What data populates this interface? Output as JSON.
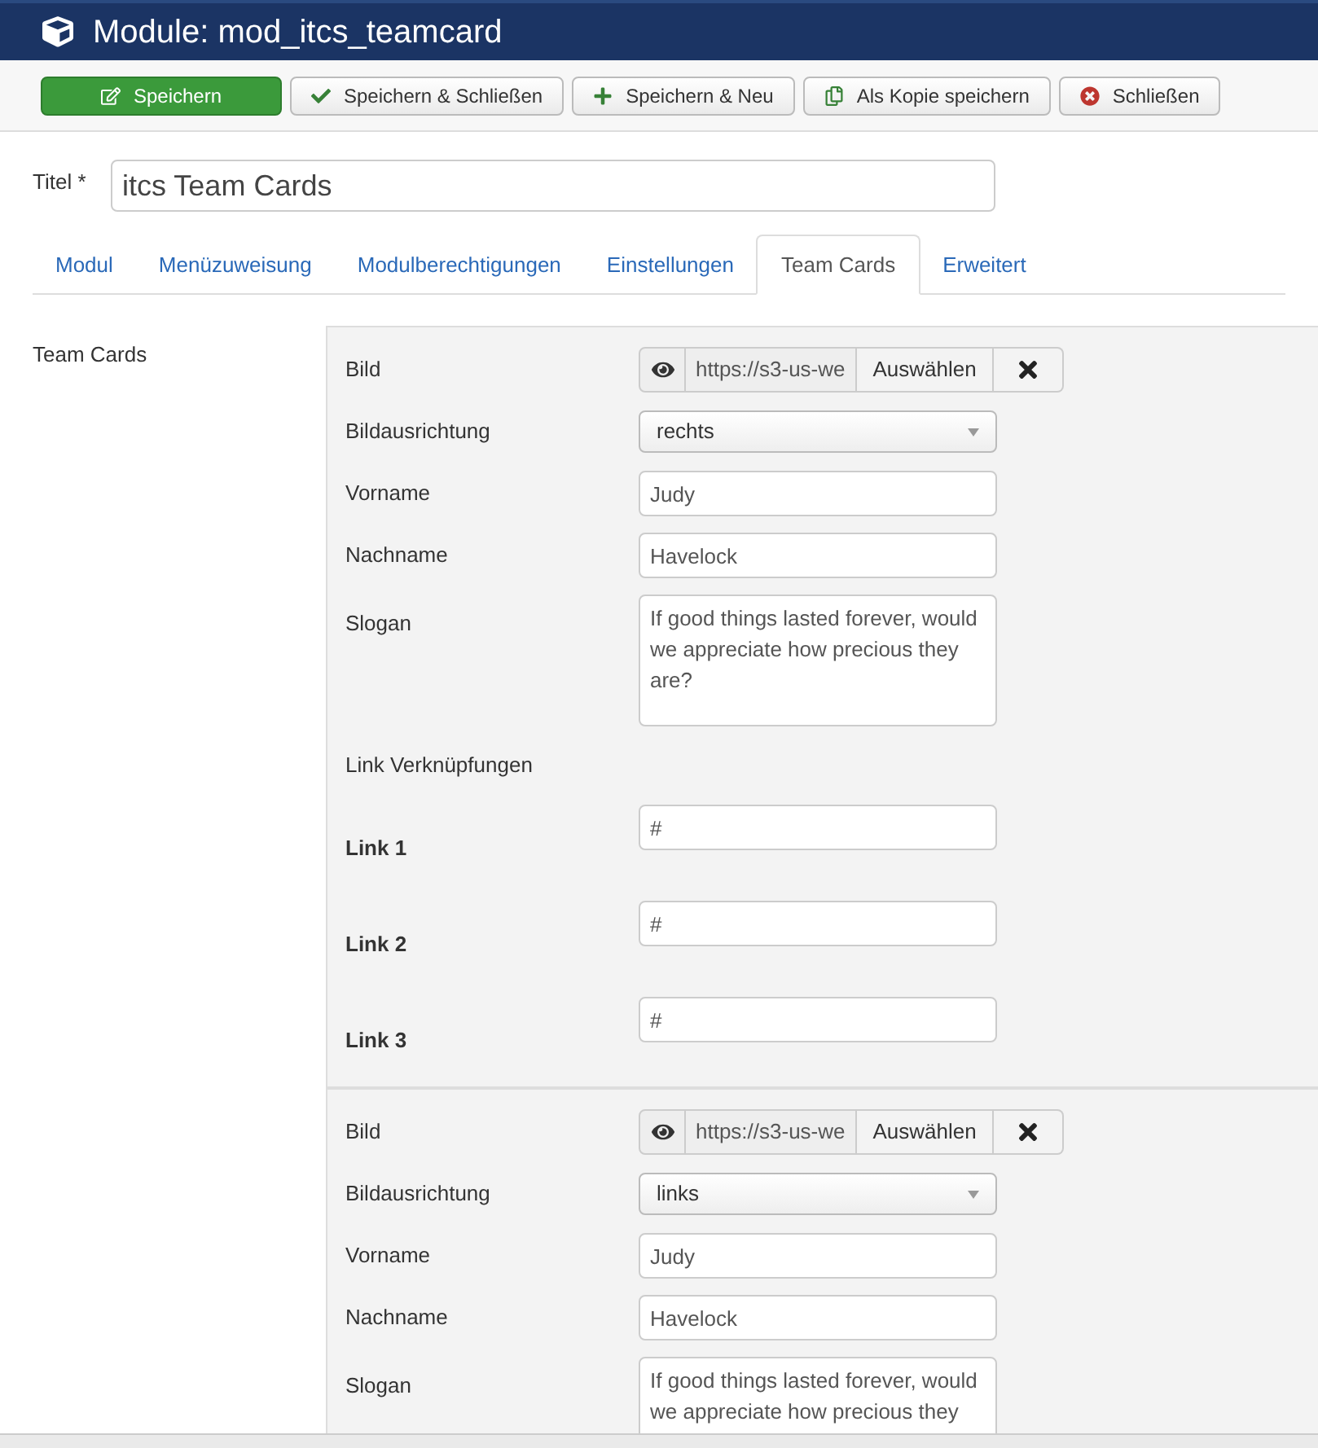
{
  "header": {
    "title": "Module: mod_itcs_teamcard"
  },
  "toolbar": [
    {
      "label": "Speichern",
      "kind": "primary"
    },
    {
      "label": "Speichern & Schließen",
      "kind": "check"
    },
    {
      "label": "Speichern & Neu",
      "kind": "plus"
    },
    {
      "label": "Als Kopie speichern",
      "kind": "copy"
    },
    {
      "label": "Schließen",
      "kind": "close"
    }
  ],
  "title_field": {
    "label": "Titel *",
    "value": "itcs Team Cards"
  },
  "tabs": [
    {
      "label": "Modul",
      "selected": false
    },
    {
      "label": "Menüzuweisung",
      "selected": false
    },
    {
      "label": "Modulberechtigungen",
      "selected": false
    },
    {
      "label": "Einstellungen",
      "selected": false
    },
    {
      "label": "Team Cards",
      "selected": true
    },
    {
      "label": "Erweitert",
      "selected": false
    }
  ],
  "section_label": "Team Cards",
  "cards": [
    {
      "fields": [
        {
          "kind": "media",
          "label": "Bild",
          "value": "https://s3-us-we",
          "button": "Auswählen"
        },
        {
          "kind": "select",
          "label": "Bildausrichtung",
          "value": "rechts"
        },
        {
          "kind": "text",
          "label": "Vorname",
          "value": "Judy"
        },
        {
          "kind": "text",
          "label": "Nachname",
          "value": "Havelock"
        },
        {
          "kind": "textarea",
          "label": "Slogan",
          "value": "If good things lasted forever, would we appreciate how precious they are?"
        },
        {
          "kind": "heading",
          "label": "Link Verknüpfungen"
        },
        {
          "kind": "link",
          "label": "Link 1",
          "value": "#"
        },
        {
          "kind": "link",
          "label": "Link 2",
          "value": "#"
        },
        {
          "kind": "link",
          "label": "Link 3",
          "value": "#"
        }
      ]
    },
    {
      "fields": [
        {
          "kind": "media",
          "label": "Bild",
          "value": "https://s3-us-we",
          "button": "Auswählen"
        },
        {
          "kind": "select",
          "label": "Bildausrichtung",
          "value": "links"
        },
        {
          "kind": "text",
          "label": "Vorname",
          "value": "Judy"
        },
        {
          "kind": "text",
          "label": "Nachname",
          "value": "Havelock"
        },
        {
          "kind": "textarea",
          "label": "Slogan",
          "value": "If good things lasted forever, would we appreciate how precious they"
        }
      ]
    }
  ]
}
